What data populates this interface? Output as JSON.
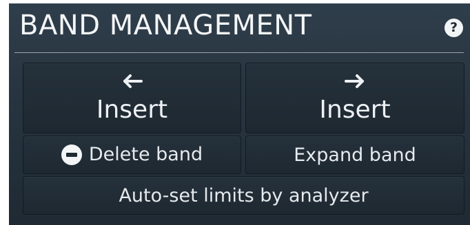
{
  "panel": {
    "title": "BAND MANAGEMENT",
    "help_icon": "question-mark-icon",
    "help_label": "?"
  },
  "buttons": {
    "insert_left": {
      "label": "Insert",
      "icon": "arrow-left-icon"
    },
    "insert_right": {
      "label": "Insert",
      "icon": "arrow-right-icon"
    },
    "delete_band": {
      "label": "Delete band",
      "icon": "minus-circle-icon"
    },
    "expand_band": {
      "label": "Expand band"
    },
    "auto_set": {
      "label": "Auto-set limits by analyzer"
    }
  },
  "colors": {
    "panel_background": "#27343f",
    "button_background": "#222d36",
    "text": "#eef1f4"
  }
}
